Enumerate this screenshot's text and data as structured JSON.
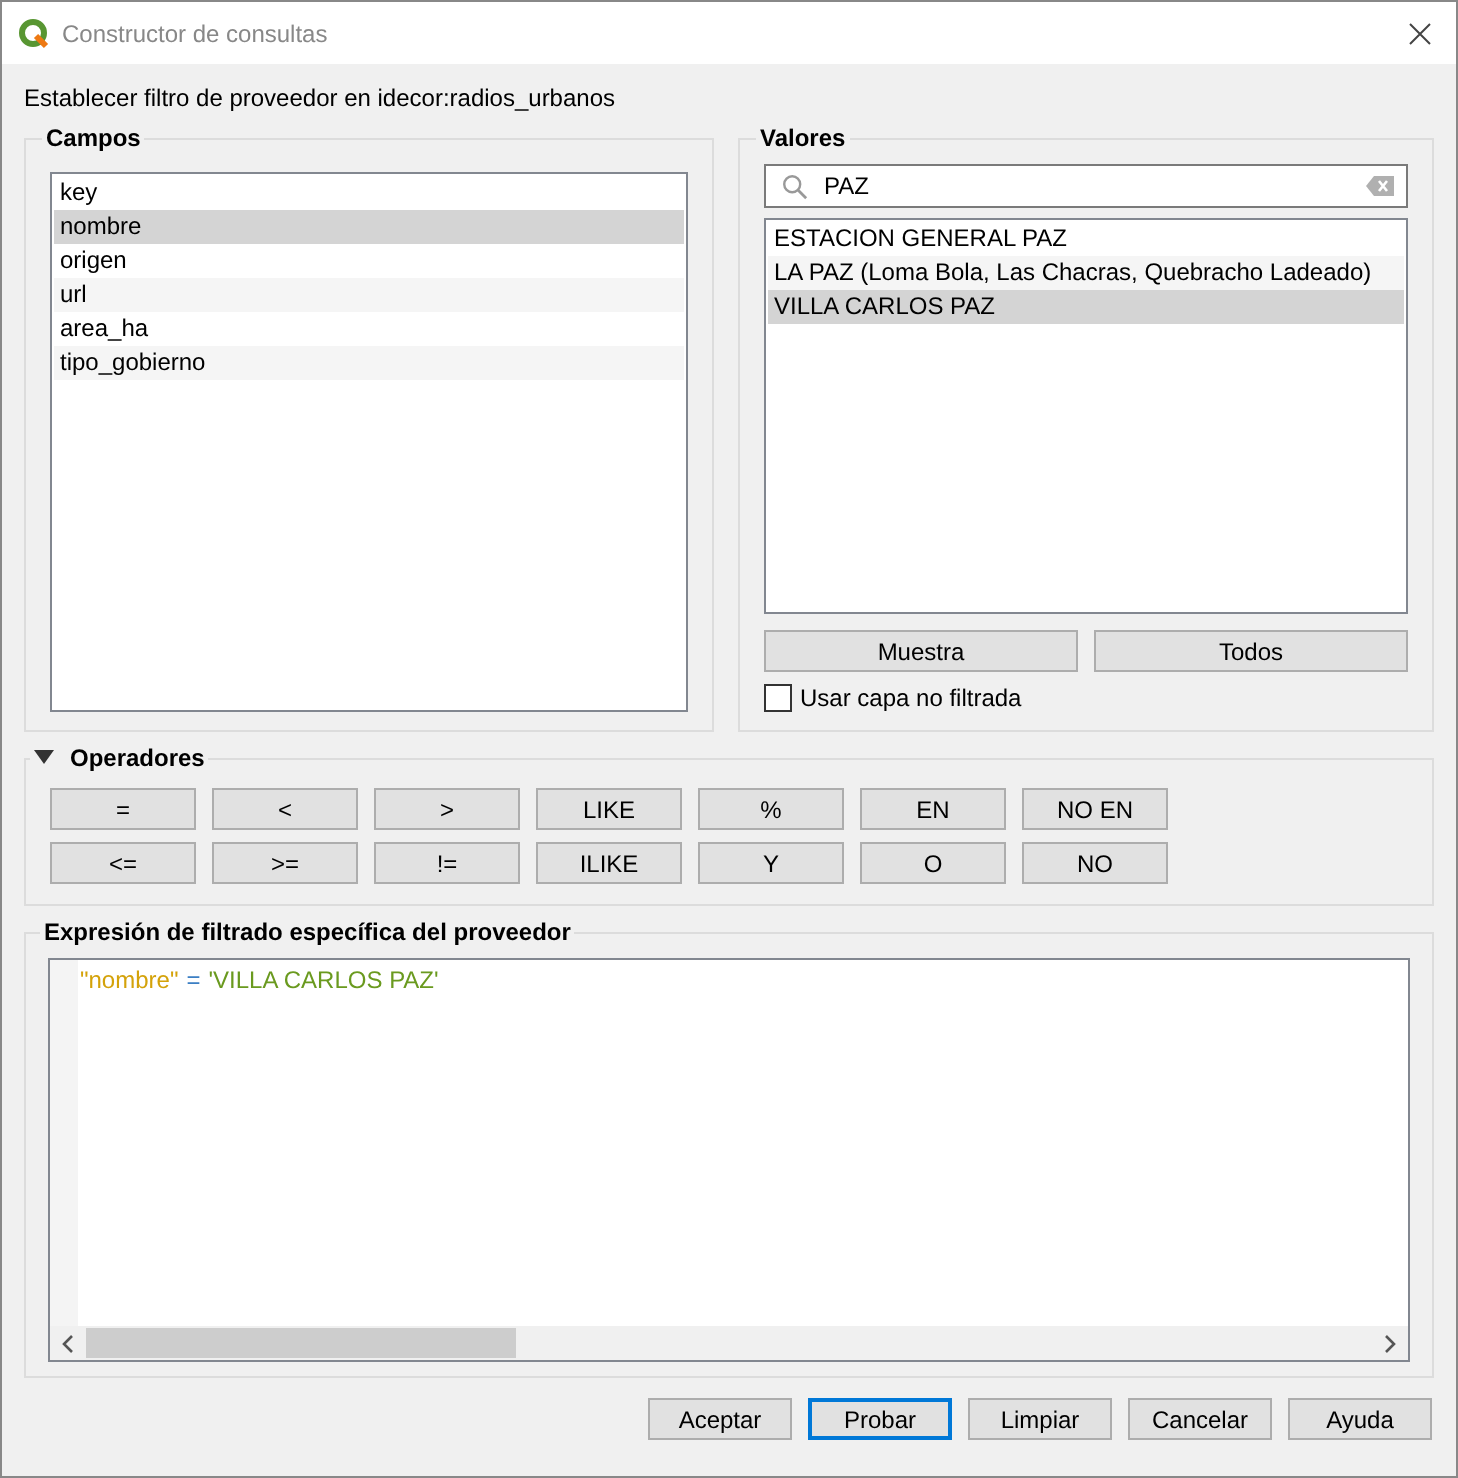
{
  "window": {
    "title": "Constructor de consultas"
  },
  "subtitle": "Establecer filtro de proveedor en idecor:radios_urbanos",
  "fields": {
    "title": "Campos",
    "items": [
      {
        "label": "key",
        "selected": false
      },
      {
        "label": "nombre",
        "selected": true
      },
      {
        "label": "origen",
        "selected": false
      },
      {
        "label": "url",
        "selected": false
      },
      {
        "label": "area_ha",
        "selected": false
      },
      {
        "label": "tipo_gobierno",
        "selected": false
      }
    ]
  },
  "values": {
    "title": "Valores",
    "search": {
      "value": "PAZ"
    },
    "items": [
      {
        "label": "ESTACION GENERAL PAZ",
        "selected": false
      },
      {
        "label": "LA PAZ (Loma Bola, Las Chacras, Quebracho Ladeado)",
        "selected": false
      },
      {
        "label": "VILLA CARLOS PAZ",
        "selected": true
      }
    ],
    "buttons": [
      "Muestra",
      "Todos"
    ],
    "checkbox": {
      "label": "Usar capa no filtrada",
      "checked": false
    }
  },
  "operators": {
    "title": "Operadores",
    "expanded": true,
    "rows": [
      [
        "=",
        "<",
        ">",
        "LIKE",
        "%",
        "EN",
        "NO EN"
      ],
      [
        "<=",
        ">=",
        "!=",
        "ILIKE",
        "Y",
        "O",
        "NO"
      ]
    ]
  },
  "expression": {
    "title": "Expresión de filtrado específica del proveedor",
    "tokens": [
      {
        "kind": "field",
        "text": "\"nombre\""
      },
      {
        "kind": "operator",
        "text": "="
      },
      {
        "kind": "string",
        "text": "'VILLA CARLOS PAZ'"
      }
    ]
  },
  "buttons": [
    {
      "label": "Aceptar",
      "focused": false
    },
    {
      "label": "Probar",
      "focused": true
    },
    {
      "label": "Limpiar",
      "focused": false
    },
    {
      "label": "Cancelar",
      "focused": false
    },
    {
      "label": "Ayuda",
      "focused": false
    }
  ]
}
